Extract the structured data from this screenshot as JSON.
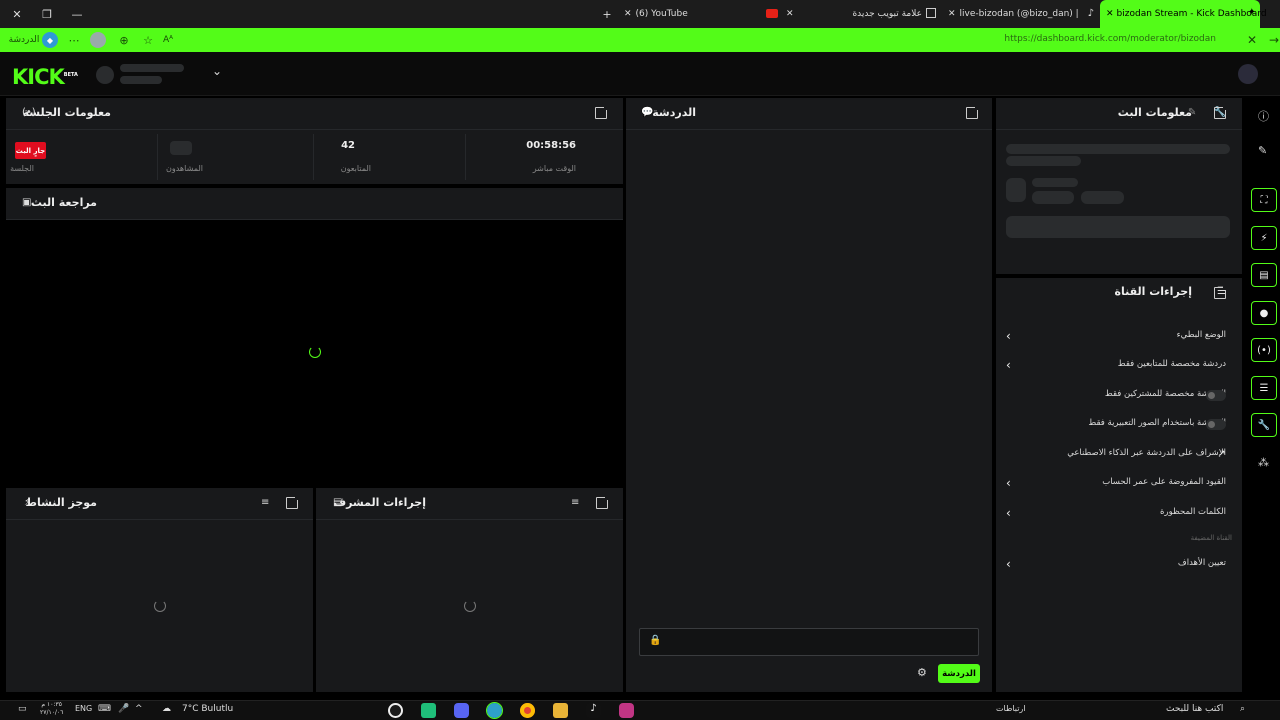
{
  "browser": {
    "tabs": [
      {
        "title": "(6) YouTube",
        "active": false
      },
      {
        "title": "علامة تبويب جديدة",
        "active": false
      },
      {
        "title": "live-bizodan (@bizo_dan) | TikTok",
        "active": false
      },
      {
        "title": "bizodan Stream - Kick Dashboard",
        "active": true
      }
    ],
    "url": "https://dashboard.kick.com/moderator/bizodan",
    "sidebar_left_label": "الدردشة",
    "accent": "#53fc18"
  },
  "header": {
    "logo": "KICK",
    "logo_badge": "BETA"
  },
  "session": {
    "title": "معلومات الجلسة",
    "live_badge": "جارٍ البث",
    "stats": [
      {
        "value": "00:58:56",
        "label": "الوقت مباشر"
      },
      {
        "value": "42",
        "label": "المتابعون"
      },
      {
        "value": "",
        "label": "المشاهدون"
      },
      {
        "value": "",
        "label": "الجلسة"
      }
    ]
  },
  "preview": {
    "title": "مراجعة البث"
  },
  "activity": {
    "title": "موجز النشاط"
  },
  "mod_actions": {
    "title": "إجراءات المشرف"
  },
  "chat": {
    "title": "الدردشة",
    "send_label": "الدردشة"
  },
  "stream_info": {
    "title": "معلومات البث"
  },
  "channel_actions": {
    "title": "إجراءات القناة",
    "items": [
      {
        "label": "الوضع البطيء",
        "control": "chevron"
      },
      {
        "label": "دردشة مخصصة للمتابعين فقط",
        "control": "chevron"
      },
      {
        "label": "الدردشة مخصصة للمشتركين فقط",
        "control": "toggle"
      },
      {
        "label": "الدردشة باستخدام الصور التعبيرية فقط",
        "control": "toggle"
      },
      {
        "label": "الإشراف على الدردشة عبر الذكاء الاصطناعي",
        "control": "external"
      },
      {
        "label": "القيود المفروضة على عمر الحساب",
        "control": "chevron"
      },
      {
        "label": "الكلمات المحظورة",
        "control": "chevron"
      }
    ],
    "section_label": "القناة المضيفة",
    "host_item": "تعيين الأهداف"
  },
  "taskbar": {
    "search_placeholder": "اكتب هنا للبحث",
    "links_label": "ارتباطات",
    "weather": "7°C  Bulutlu",
    "lang": "ENG",
    "time": "١٠:٣٥ م",
    "date": "٢٧/١٠/٠٦"
  }
}
